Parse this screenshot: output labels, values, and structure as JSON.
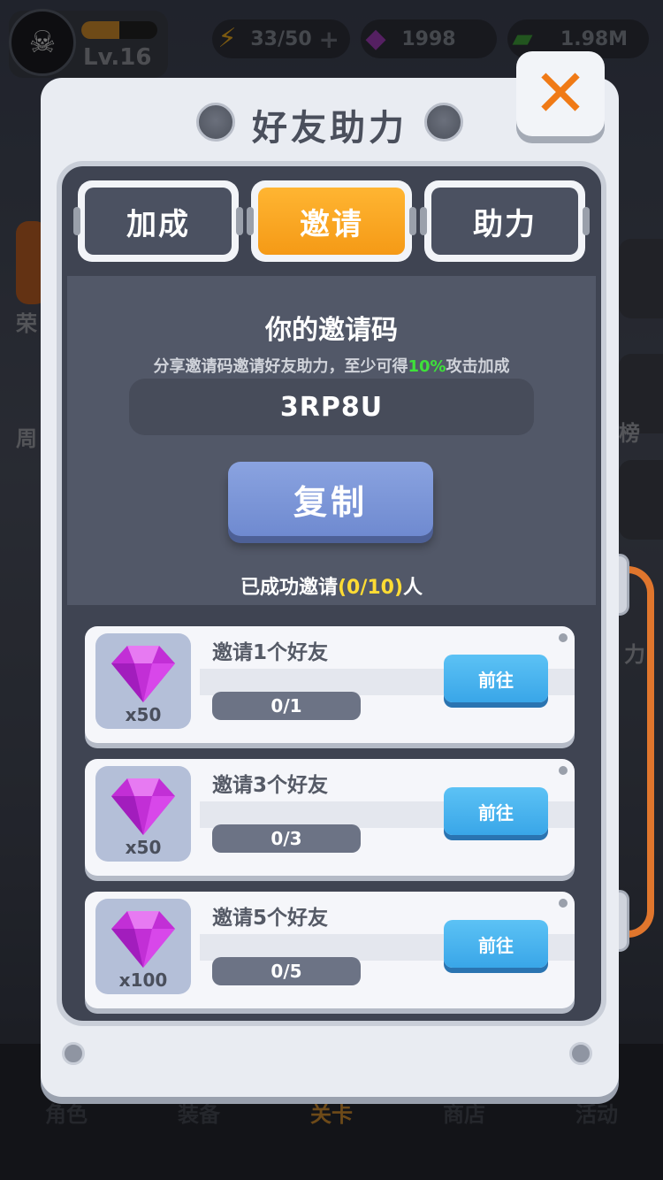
{
  "topbar": {
    "level": "Lv.16",
    "xp_fraction": 0.5,
    "energy": "33/50",
    "gems": "1998",
    "cash": "1.98M"
  },
  "side": {
    "left_labels": [
      "荣",
      "周"
    ],
    "right_labels": [
      "榜",
      "力"
    ]
  },
  "bottom_nav": {
    "items": [
      "角色",
      "装备",
      "关卡",
      "商店",
      "活动"
    ],
    "active": "关卡"
  },
  "dialog": {
    "title": "好友助力",
    "tabs": [
      {
        "label": "加成",
        "active": false
      },
      {
        "label": "邀请",
        "active": true
      },
      {
        "label": "助力",
        "active": false
      }
    ],
    "invite": {
      "heading": "你的邀请码",
      "desc_prefix": "分享邀请码邀请好友助力，至少可得",
      "desc_highlight": "10%",
      "desc_suffix": "攻击加成",
      "code": "3RP8U",
      "copy_label": "复制",
      "success_prefix": "已成功邀请",
      "success_count": "(0/10)",
      "success_suffix": "人"
    },
    "tasks": [
      {
        "title": "邀请1个好友",
        "reward_qty": "x50",
        "progress": "0/1",
        "button": "前往"
      },
      {
        "title": "邀请3个好友",
        "reward_qty": "x50",
        "progress": "0/3",
        "button": "前往"
      },
      {
        "title": "邀请5个好友",
        "reward_qty": "x100",
        "progress": "0/5",
        "button": "前往"
      }
    ]
  },
  "colors": {
    "accent_orange": "#f59a16",
    "highlight_green": "#3ee13a",
    "highlight_yellow": "#ffdc34",
    "go_button_blue": "#39a6e8"
  }
}
